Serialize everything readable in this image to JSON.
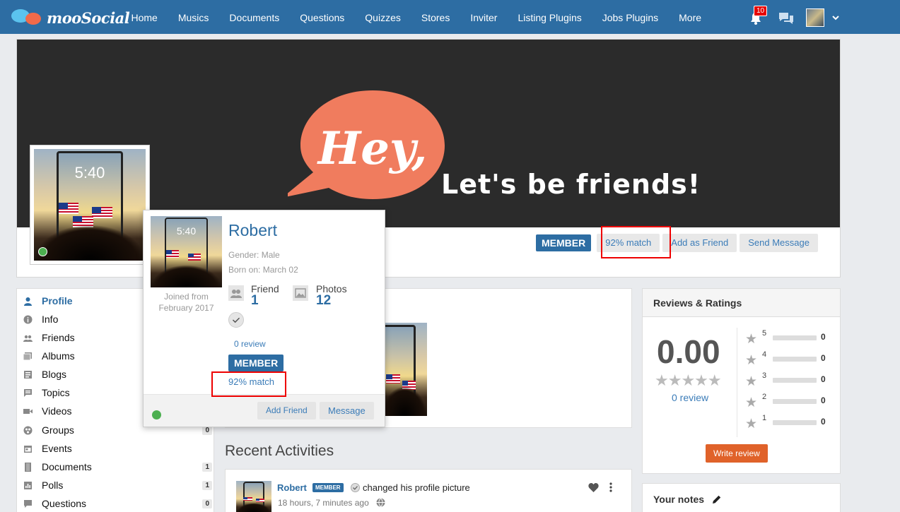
{
  "header": {
    "logo_text": "mooSocial",
    "nav": [
      "Home",
      "Musics",
      "Documents",
      "Questions",
      "Quizzes",
      "Stores",
      "Inviter",
      "Listing Plugins",
      "Jobs Plugins",
      "More"
    ],
    "notification_count": "10",
    "icons": [
      "bell-icon",
      "chat-icon",
      "avatar",
      "chevron-down-icon"
    ]
  },
  "cover": {
    "bubble_text": "Hey,",
    "tagline": "Let's be friends!",
    "bubble_color": "#f07c5e",
    "avatar_clock": "5:40",
    "actions": {
      "member": "MEMBER",
      "match": "92% match",
      "add_friend": "Add as Friend",
      "send_message": "Send Message"
    }
  },
  "sidebar": {
    "items": [
      {
        "label": "Profile",
        "icon": "user-icon",
        "count": ""
      },
      {
        "label": "Info",
        "icon": "info-icon",
        "count": ""
      },
      {
        "label": "Friends",
        "icon": "friends-icon",
        "count": ""
      },
      {
        "label": "Albums",
        "icon": "albums-icon",
        "count": ""
      },
      {
        "label": "Blogs",
        "icon": "blogs-icon",
        "count": ""
      },
      {
        "label": "Topics",
        "icon": "topics-icon",
        "count": ""
      },
      {
        "label": "Videos",
        "icon": "video-icon",
        "count": ""
      },
      {
        "label": "Groups",
        "icon": "groups-icon",
        "count": "0"
      },
      {
        "label": "Events",
        "icon": "calendar-icon",
        "count": ""
      },
      {
        "label": "Documents",
        "icon": "document-icon",
        "count": "1"
      },
      {
        "label": "Polls",
        "icon": "poll-icon",
        "count": "1"
      },
      {
        "label": "Questions",
        "icon": "question-icon",
        "count": "0"
      }
    ]
  },
  "hover_card": {
    "name": "Robert",
    "gender_label": "Gender:",
    "gender": "Male",
    "born_label": "Born on:",
    "born": "March 02",
    "joined_line1": "Joined from",
    "joined_line2": "February 2017",
    "friend_label": "Friend",
    "friend_count": "1",
    "photos_label": "Photos",
    "photos_count": "12",
    "review": "0 review",
    "member": "MEMBER",
    "match": "92% match",
    "add_friend": "Add Friend",
    "message": "Message"
  },
  "recent": {
    "title": "Recent Activities",
    "activity": {
      "name": "Robert",
      "badge": "MEMBER",
      "text": "changed his profile picture",
      "time": "18 hours, 7 minutes ago"
    }
  },
  "reviews": {
    "title": "Reviews & Ratings",
    "score": "0.00",
    "stars": "★★★★★",
    "review_link": "0 review",
    "rows": [
      {
        "star": "5",
        "count": "0"
      },
      {
        "star": "4",
        "count": "0"
      },
      {
        "star": "3",
        "count": "0"
      },
      {
        "star": "2",
        "count": "0"
      },
      {
        "star": "1",
        "count": "0"
      }
    ],
    "write_review": "Write review"
  },
  "notes": {
    "title": "Your notes"
  },
  "colors": {
    "nav": "#2d6da3",
    "accent": "#2d6da3",
    "orange": "#e0622a",
    "online": "#4caf50",
    "highlight": "#e00000"
  }
}
